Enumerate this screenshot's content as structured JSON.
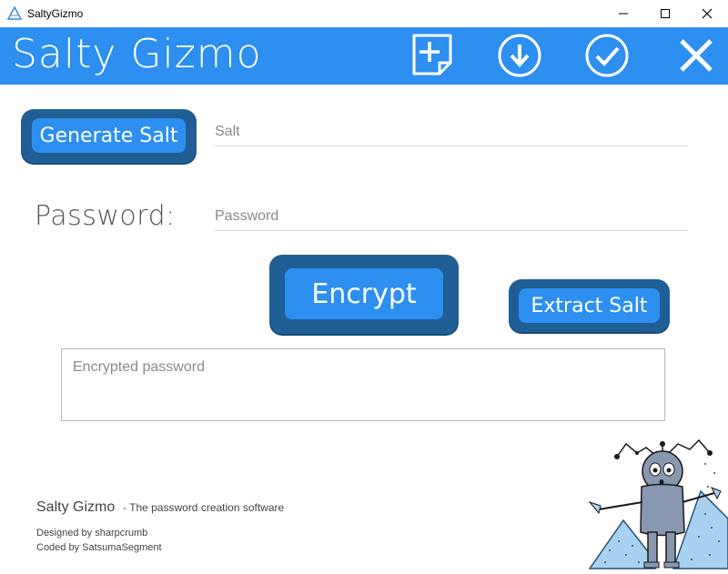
{
  "window": {
    "title": "SaltyGizmo",
    "controls": {
      "minimize": "minimize-icon",
      "maximize": "maximize-icon",
      "close": "close-icon"
    }
  },
  "header": {
    "brand": "Salty Gizmo",
    "background": "#2d8ff0",
    "icons": [
      "new-document-icon",
      "download-icon",
      "check-icon",
      "close-icon"
    ]
  },
  "salt": {
    "button_label": "Generate Salt",
    "placeholder": "Salt",
    "value": ""
  },
  "password": {
    "label": "Password:",
    "placeholder": "Password",
    "value": ""
  },
  "actions": {
    "encrypt_label": "Encrypt",
    "extract_label": "Extract Salt"
  },
  "output": {
    "placeholder": "Encrypted password",
    "value": ""
  },
  "footer": {
    "brand": "Salty Gizmo",
    "tagline": "- The password creation software",
    "designed_by": "Designed by sharpcrumb",
    "coded_by": "Coded by SatsumaSegment"
  },
  "colors": {
    "accent": "#2d8ff0",
    "button_edge": "#1f5f96"
  }
}
